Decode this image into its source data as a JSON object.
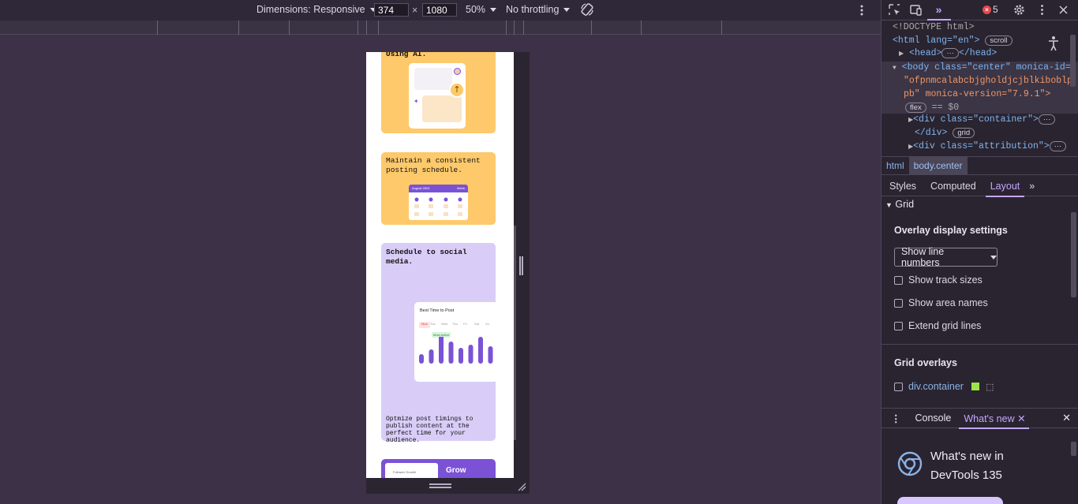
{
  "device_toolbar": {
    "dimensions_label": "Dimensions: Responsive",
    "width": "374",
    "times": "×",
    "height": "1080",
    "zoom": "50%",
    "throttling": "No throttling"
  },
  "page": {
    "card1_text": "Using AI.",
    "card2_text": "Maintain a consistent posting schedule.",
    "card2_calendar_title": "August 2024",
    "card2_calendar_view": "Week",
    "card3_title": "Schedule to social media.",
    "card3_widget_title": "Best Time to Post",
    "card3_days": [
      "Mon",
      "Tue",
      "Wed",
      "Thu",
      "Fri",
      "Sat",
      "Su"
    ],
    "card3_badge": "Most Active",
    "card3_text": "Optmize post timings to publish content at the perfect time for your audience.",
    "card4_label": "Follower Growth",
    "card4_title": "Grow"
  },
  "devtools": {
    "error_count": "5",
    "elements": {
      "doctype": "<!DOCTYPE html>",
      "html_open": "<html lang=\"en\">",
      "scroll_pill": "scroll",
      "head": "<head>",
      "head_close": "</head>",
      "body_l1": "<body class=\"center\" monica-id=",
      "body_l2": "\"ofpnmcalabcbjgholdjcjblkiboblp",
      "body_l3": "pb\" monica-version=\"7.9.1\">",
      "flex_pill": "flex",
      "eq_dollar": "== $0",
      "div_container": "<div class=\"container\">",
      "div_close": "</div>",
      "grid_pill": "grid",
      "div_attribution": "<div class=\"attribution\">"
    },
    "breadcrumbs": [
      "html",
      "body.center"
    ],
    "panel_tabs": [
      "Styles",
      "Computed",
      "Layout"
    ],
    "grid_section": "Grid",
    "overlay_heading": "Overlay display settings",
    "select_value": "Show line numbers",
    "checkboxes": [
      "Show track sizes",
      "Show area names",
      "Extend grid lines"
    ],
    "grid_overlays_heading": "Grid overlays",
    "overlay_item": "div.container",
    "overlay_color": "#9be34b",
    "drawer_tabs": [
      "Console",
      "What's new"
    ],
    "whatsnew_title_l1": "What's new in",
    "whatsnew_title_l2": "DevTools 135"
  },
  "colors": {
    "card_yellow": "#fdc96a",
    "card_lilac": "#d9cdf8",
    "card_purple": "#7b52d6",
    "accent": "#c3a6ff",
    "error_red": "#e5484d"
  }
}
